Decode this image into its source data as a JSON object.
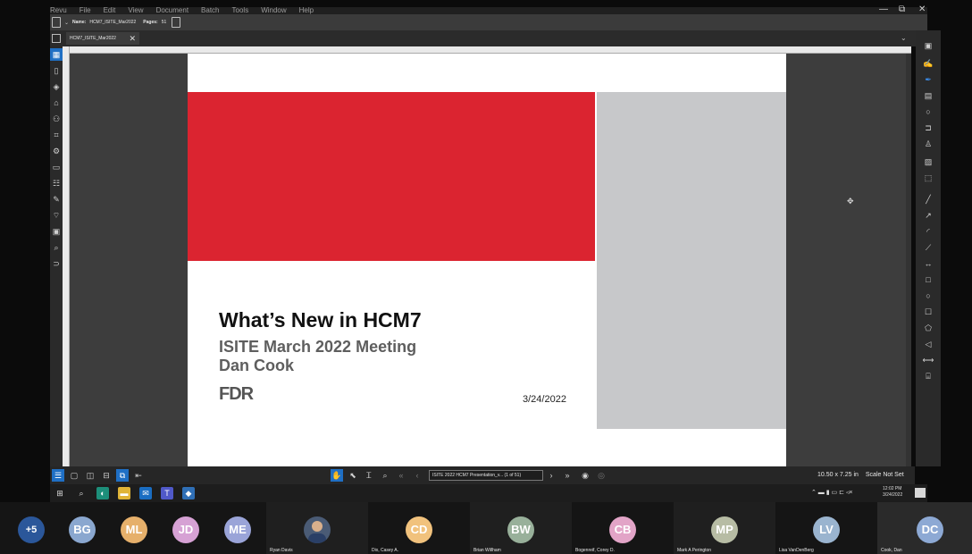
{
  "menubar": {
    "items": [
      "Revu",
      "File",
      "Edit",
      "View",
      "Document",
      "Batch",
      "Tools",
      "Window",
      "Help"
    ],
    "win_controls": [
      "—",
      "⧉",
      "✕"
    ]
  },
  "toolbar": {
    "name_label": "Name:",
    "name_value": "HCM7_ISITE_Mar2022",
    "pages_label": "Pages:",
    "pages_value": "51"
  },
  "tab": {
    "label": "HCM7_ISITE_Mar2022",
    "close": "✕"
  },
  "slide": {
    "title": "What’s New in HCM7",
    "subtitle": "ISITE March 2022 Meeting",
    "author": "Dan Cook",
    "logo_text": "FDR",
    "date": "3/24/2022",
    "colors": {
      "red": "#db2430",
      "grey": "#c7c8ca"
    }
  },
  "statusbar": {
    "page_field": "ISITE 2022 HCM7 Presentation_v... (1 of 51)",
    "page_size": "10.50 x 7.25 in",
    "scale": "Scale Not Set"
  },
  "taskbar": {
    "clock_time": "12:02 PM",
    "clock_date": "3/24/2022"
  },
  "participants": [
    {
      "initials": "+5",
      "color": "#2b579a",
      "name": ""
    },
    {
      "initials": "BG",
      "color": "#8aa7cf",
      "name": ""
    },
    {
      "initials": "ML",
      "color": "#e6b06b",
      "name": ""
    },
    {
      "initials": "JD",
      "color": "#d6a1d4",
      "name": ""
    },
    {
      "initials": "ME",
      "color": "#9aa4d8",
      "name": ""
    },
    {
      "initials": "",
      "color": "#4a5b75",
      "name": "Ryan Davis"
    },
    {
      "initials": "CD",
      "color": "#f1c27d",
      "name": "Dix, Casey A."
    },
    {
      "initials": "BW",
      "color": "#98b09a",
      "name": "Brian Willham"
    },
    {
      "initials": "CB",
      "color": "#e2a4c7",
      "name": "Bogenreif, Corey D."
    },
    {
      "initials": "MP",
      "color": "#b7bca4",
      "name": "Mark A Perington"
    },
    {
      "initials": "LV",
      "color": "#9ab4cf",
      "name": "Lisa VanDenBerg"
    },
    {
      "initials": "DC",
      "color": "#8da9d4",
      "name": "Cook, Dan"
    }
  ]
}
